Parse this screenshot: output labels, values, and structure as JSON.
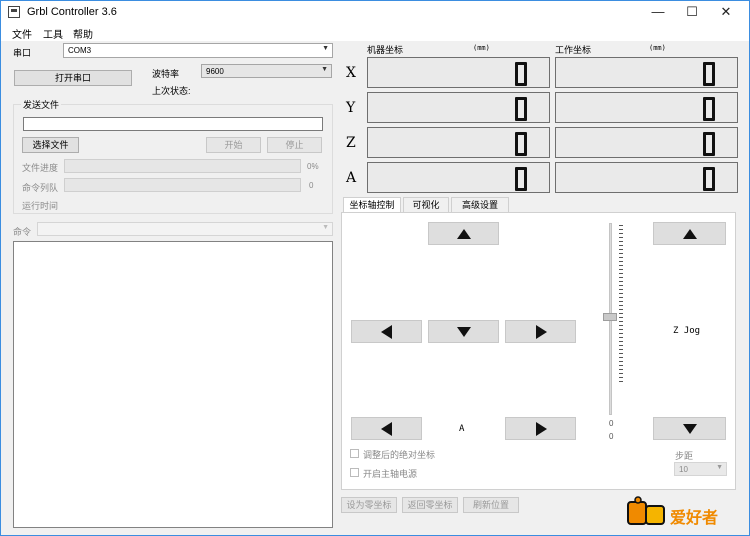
{
  "window": {
    "title": "Grbl Controller 3.6",
    "controls": {
      "minimize": "—",
      "maximize": "☐",
      "close": "✕"
    }
  },
  "menu": [
    "文件",
    "工具",
    "帮助"
  ],
  "connection": {
    "port_label": "串口",
    "port_value": "COM3",
    "open_button": "打开串口",
    "baud_label": "波特率",
    "baud_value": "9600",
    "last_state_label": "上次状态:"
  },
  "send_file": {
    "group_title": "发送文件",
    "path_value": "",
    "choose_button": "选择文件",
    "start_button": "开始",
    "stop_button": "停止",
    "file_progress_label": "文件进度",
    "file_progress_value": "0%",
    "file_progress_fraction": 0,
    "queue_label": "命令列队",
    "queue_value": "0",
    "queue_fraction": 0,
    "runtime_label": "运行时间"
  },
  "command": {
    "label": "命令",
    "value": ""
  },
  "coordinates": {
    "machine_header": "机器坐标",
    "machine_unit": "(mm)",
    "work_header": "工作坐标",
    "work_unit": "(mm)",
    "axes": [
      {
        "name": "X",
        "machine": "0",
        "work": "0"
      },
      {
        "name": "Y",
        "machine": "0",
        "work": "0"
      },
      {
        "name": "Z",
        "machine": "0",
        "work": "0"
      },
      {
        "name": "A",
        "machine": "0",
        "work": "0"
      }
    ]
  },
  "tabs": [
    {
      "label": "坐标轴控制",
      "active": true
    },
    {
      "label": "可视化",
      "active": false
    },
    {
      "label": "高级设置",
      "active": false
    }
  ],
  "jog": {
    "z_jog_label": "Z Jog",
    "a_label": "A",
    "slider_min_1": "0",
    "slider_min_2": "0",
    "abs_coord_checkbox": "调整后的绝对坐标",
    "spindle_checkbox": "开启主轴电源",
    "step_label": "步距",
    "step_value": "10"
  },
  "bottom_buttons": [
    "设为零坐标",
    "返回零坐标",
    "刷新位置"
  ],
  "watermark": "爱好者",
  "colors": {
    "accent_border": "#3b8de0",
    "lcd_bg": "#eaeaea",
    "watermark_orange": "#f08a00"
  }
}
